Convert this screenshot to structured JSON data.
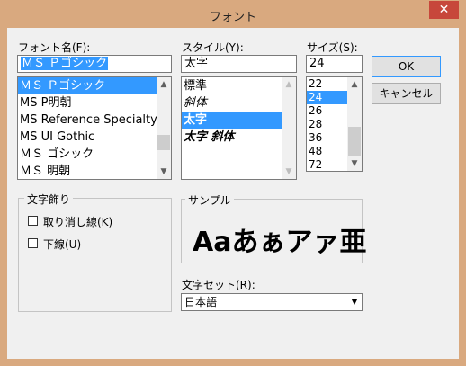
{
  "window": {
    "title": "フォント",
    "close_glyph": "✕"
  },
  "font": {
    "label": "フォント名(F):",
    "value": "ＭＳ Ｐゴシック",
    "items": [
      "ＭＳ Ｐゴシック",
      "MS P明朝",
      "MS Reference Specialty",
      "MS UI Gothic",
      "ＭＳ ゴシック",
      "ＭＳ 明朝"
    ],
    "selected_index": 0
  },
  "style": {
    "label": "スタイル(Y):",
    "value": "太字",
    "items": [
      "標準",
      "斜体",
      "太字",
      "太字 斜体"
    ],
    "selected_index": 2
  },
  "size": {
    "label": "サイズ(S):",
    "value": "24",
    "items": [
      "22",
      "24",
      "26",
      "28",
      "36",
      "48",
      "72"
    ],
    "selected_index": 1
  },
  "buttons": {
    "ok": "OK",
    "cancel": "キャンセル"
  },
  "effects": {
    "title": "文字飾り",
    "strikeout": "取り消し線(K)",
    "underline": "下線(U)"
  },
  "sample": {
    "title": "サンプル",
    "text": "Aaあぁアァ亜"
  },
  "script": {
    "label": "文字セット(R):",
    "value": "日本語"
  },
  "icons": {
    "scroll_up": "▲",
    "scroll_down": "▼",
    "dropdown": "▼"
  },
  "colors": {
    "selection": "#3399ff",
    "frame": "#d9a97f",
    "close": "#c7473b"
  }
}
